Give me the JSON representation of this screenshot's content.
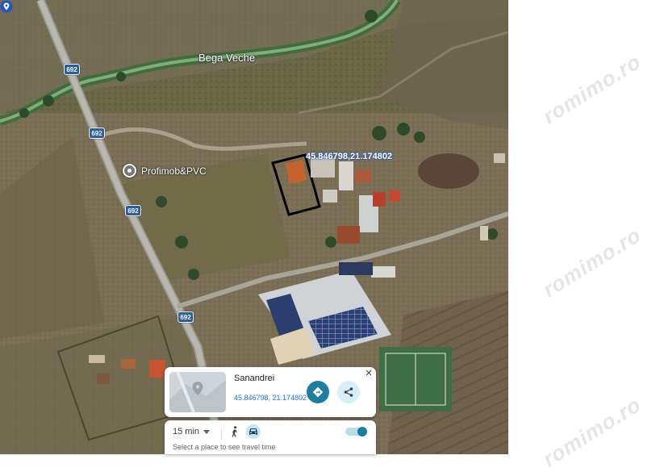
{
  "map": {
    "river_label": "Bega Veche",
    "road_shields": [
      "692",
      "692",
      "692",
      "692"
    ],
    "poi": {
      "label": "Profimob&PVC",
      "icon": "place-pin-icon"
    },
    "marker": {
      "label": "45.846798,21.174802",
      "icon": "location-pin-icon"
    },
    "watermark": "romimo.ro"
  },
  "place_card": {
    "name": "Sanandrei",
    "coords": "45.846798, 21.174802",
    "directions_icon": "directions-icon",
    "share_icon": "share-icon",
    "close_label": "✕"
  },
  "travel_panel": {
    "time": "15 min",
    "hint": "Select a place to see travel time",
    "modes": [
      "walk-icon",
      "car-icon"
    ],
    "selected_mode": "car-icon",
    "toggle_on": true
  },
  "colors": {
    "accent": "#1a7fa0",
    "link": "#1a73e8",
    "shield": "#2a5fa8",
    "selected_mode_bg": "#c6e6f3"
  }
}
